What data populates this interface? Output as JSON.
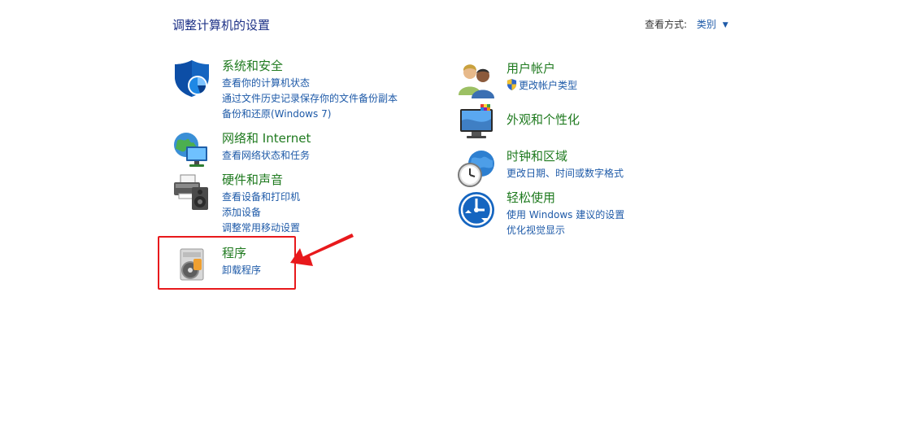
{
  "page_title": "调整计算机的设置",
  "view_by": {
    "label": "查看方式:",
    "value": "类别"
  },
  "left_categories": [
    {
      "heading": "系统和安全",
      "icon": "shield-icon",
      "links": [
        "查看你的计算机状态",
        "通过文件历史记录保存你的文件备份副本",
        "备份和还原(Windows 7)"
      ]
    },
    {
      "heading": "网络和 Internet",
      "icon": "network-globe-icon",
      "links": [
        "查看网络状态和任务"
      ]
    },
    {
      "heading": "硬件和声音",
      "icon": "printer-speaker-icon",
      "links": [
        "查看设备和打印机",
        "添加设备",
        "调整常用移动设置"
      ]
    },
    {
      "heading": "程序",
      "icon": "programs-disc-icon",
      "links": [
        "卸载程序"
      ]
    }
  ],
  "right_categories": [
    {
      "heading": "用户帐户",
      "icon": "users-icon",
      "links": [
        "更改帐户类型"
      ]
    },
    {
      "heading": "外观和个性化",
      "icon": "monitor-palette-icon",
      "links": []
    },
    {
      "heading": "时钟和区域",
      "icon": "clock-globe-icon",
      "links": [
        "更改日期、时间或数字格式"
      ]
    },
    {
      "heading": "轻松使用",
      "icon": "ease-of-access-icon",
      "links": [
        "使用 Windows 建议的设置",
        "优化视觉显示"
      ]
    }
  ],
  "annotation": {
    "color": "#e8191c",
    "highlighted": "程序"
  }
}
